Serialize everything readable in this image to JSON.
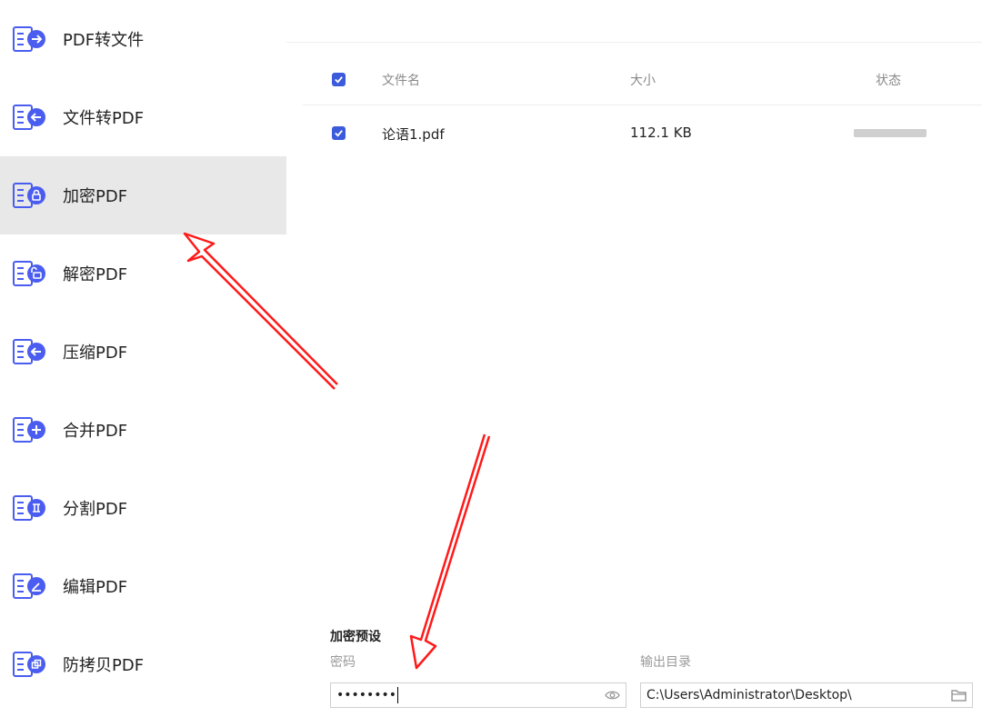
{
  "sidebar": {
    "items": [
      {
        "label": "PDF转文件",
        "icon": "pdf-to-file-icon"
      },
      {
        "label": "文件转PDF",
        "icon": "file-to-pdf-icon"
      },
      {
        "label": "加密PDF",
        "icon": "lock-icon",
        "active": true
      },
      {
        "label": "解密PDF",
        "icon": "unlock-icon"
      },
      {
        "label": "压缩PDF",
        "icon": "compress-icon"
      },
      {
        "label": "合并PDF",
        "icon": "merge-icon"
      },
      {
        "label": "分割PDF",
        "icon": "split-icon"
      },
      {
        "label": "编辑PDF",
        "icon": "edit-icon"
      },
      {
        "label": "防拷贝PDF",
        "icon": "copy-protect-icon"
      }
    ]
  },
  "table": {
    "headers": {
      "name": "文件名",
      "size": "大小",
      "status": "状态"
    },
    "rows": [
      {
        "name": "论语1.pdf",
        "size": "112.1 KB",
        "checked": true
      }
    ],
    "all_checked": true
  },
  "settings": {
    "title": "加密预设",
    "password_label": "密码",
    "password_value": "••••••••",
    "output_label": "输出目录",
    "output_value": "C:\\Users\\Administrator\\Desktop\\"
  },
  "colors": {
    "accent": "#3b5bdb",
    "icon_blue": "#4a5df0",
    "active_bg": "#e8e8e8",
    "arrow": "#ff1a1a"
  }
}
